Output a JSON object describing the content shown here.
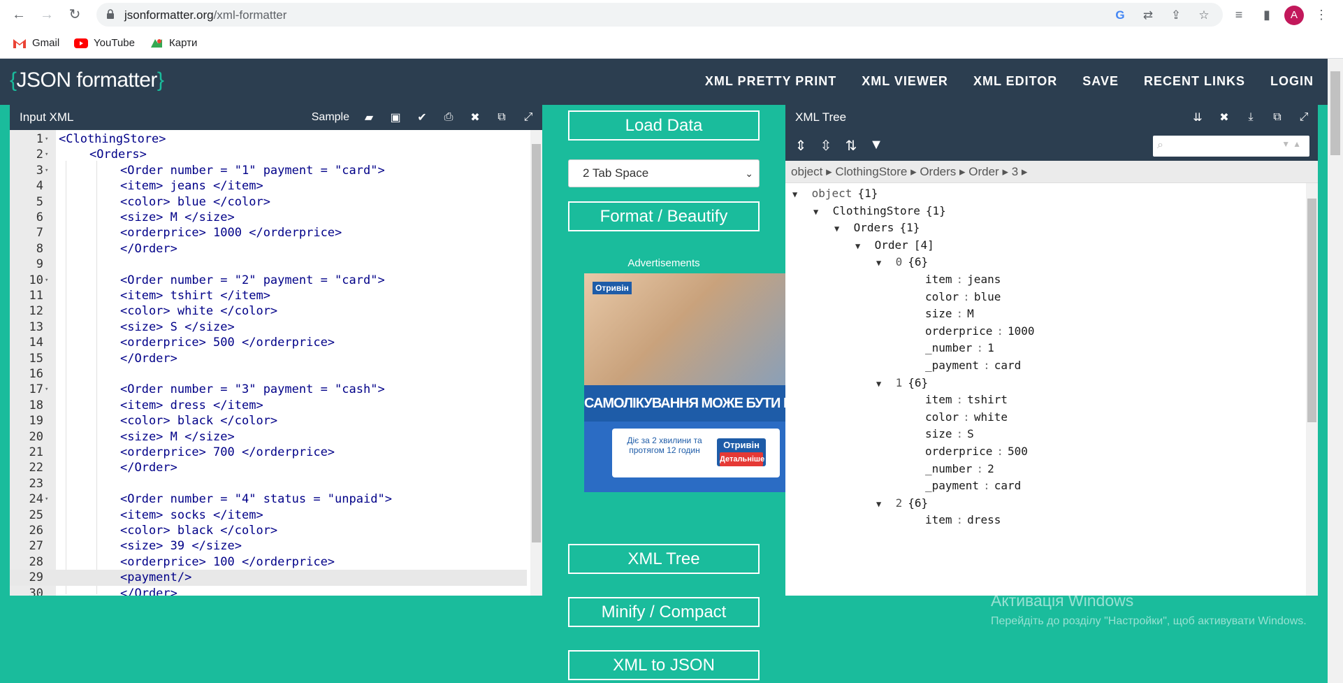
{
  "browser": {
    "url_host": "jsonformatter.org",
    "url_path": "/xml-formatter",
    "avatar_letter": "A",
    "bookmarks": [
      {
        "label": "Gmail",
        "icon": "gmail-icon"
      },
      {
        "label": "YouTube",
        "icon": "youtube-icon"
      },
      {
        "label": "Карти",
        "icon": "maps-icon"
      }
    ]
  },
  "site": {
    "logo_open": "{",
    "logo_text": "JSON formatter",
    "logo_close": "}",
    "nav": [
      "XML PRETTY PRINT",
      "XML VIEWER",
      "XML EDITOR",
      "SAVE",
      "RECENT LINKS",
      "LOGIN"
    ]
  },
  "input_panel": {
    "title": "Input XML",
    "sample_label": "Sample",
    "lines": [
      {
        "n": "1",
        "fold": true,
        "text": "<ClothingStore>",
        "indent": 0
      },
      {
        "n": "2",
        "fold": true,
        "text": "<Orders>",
        "indent": 1
      },
      {
        "n": "3",
        "fold": true,
        "text": "<Order number = \"1\" payment = \"card\">",
        "indent": 2
      },
      {
        "n": "4",
        "fold": false,
        "text": "<item> jeans </item>",
        "indent": 2
      },
      {
        "n": "5",
        "fold": false,
        "text": "<color> blue </color>",
        "indent": 2
      },
      {
        "n": "6",
        "fold": false,
        "text": "<size> M </size>",
        "indent": 2
      },
      {
        "n": "7",
        "fold": false,
        "text": "<orderprice> 1000 </orderprice>",
        "indent": 2
      },
      {
        "n": "8",
        "fold": false,
        "text": "</Order>",
        "indent": 2
      },
      {
        "n": "9",
        "fold": false,
        "text": "",
        "indent": 0
      },
      {
        "n": "10",
        "fold": true,
        "text": "<Order number = \"2\" payment = \"card\">",
        "indent": 2
      },
      {
        "n": "11",
        "fold": false,
        "text": "<item> tshirt </item>",
        "indent": 2
      },
      {
        "n": "12",
        "fold": false,
        "text": "<color> white </color>",
        "indent": 2
      },
      {
        "n": "13",
        "fold": false,
        "text": "<size> S </size>",
        "indent": 2
      },
      {
        "n": "14",
        "fold": false,
        "text": "<orderprice> 500 </orderprice>",
        "indent": 2
      },
      {
        "n": "15",
        "fold": false,
        "text": "</Order>",
        "indent": 2
      },
      {
        "n": "16",
        "fold": false,
        "text": "",
        "indent": 0
      },
      {
        "n": "17",
        "fold": true,
        "text": "<Order number = \"3\" payment = \"cash\">",
        "indent": 2
      },
      {
        "n": "18",
        "fold": false,
        "text": "<item> dress </item>",
        "indent": 2
      },
      {
        "n": "19",
        "fold": false,
        "text": "<color> black </color>",
        "indent": 2
      },
      {
        "n": "20",
        "fold": false,
        "text": "<size> M </size>",
        "indent": 2
      },
      {
        "n": "21",
        "fold": false,
        "text": "<orderprice> 700 </orderprice>",
        "indent": 2
      },
      {
        "n": "22",
        "fold": false,
        "text": "</Order>",
        "indent": 2
      },
      {
        "n": "23",
        "fold": false,
        "text": "",
        "indent": 0
      },
      {
        "n": "24",
        "fold": true,
        "text": "<Order number = \"4\" status = \"unpaid\">",
        "indent": 2
      },
      {
        "n": "25",
        "fold": false,
        "text": "<item> socks </item>",
        "indent": 2
      },
      {
        "n": "26",
        "fold": false,
        "text": "<color> black </color>",
        "indent": 2
      },
      {
        "n": "27",
        "fold": false,
        "text": "<size> 39 </size>",
        "indent": 2
      },
      {
        "n": "28",
        "fold": false,
        "text": "<orderprice> 100 </orderprice>",
        "indent": 2
      },
      {
        "n": "29",
        "fold": false,
        "text": "<payment/>",
        "indent": 2,
        "active": true
      },
      {
        "n": "30",
        "fold": false,
        "text": "</Order>",
        "indent": 2
      }
    ]
  },
  "middle": {
    "load_data": "Load Data",
    "tab_select": "2 Tab Space",
    "format": "Format / Beautify",
    "ads_label": "Advertisements",
    "ad_banner_text": "САМОЛІКУВАННЯ МОЖЕ БУТИ ШКІДЛИВИМ ДЛЯ ВАШОГО",
    "ad_brand": "Отривін",
    "ad_card_text": "Діє за 2 хвилини та протягом 12 годин",
    "ad_card_button": "Детальніше",
    "xml_tree": "XML Tree",
    "minify": "Minify / Compact",
    "xml_to_json": "XML to JSON"
  },
  "tree_panel": {
    "title": "XML Tree",
    "breadcrumb": "object ▸ ClothingStore ▸ Orders ▸ Order ▸ 3 ▸",
    "rows": [
      {
        "depth": 0,
        "tri": "▼",
        "key": "object",
        "count": "{1}",
        "grey": true
      },
      {
        "depth": 1,
        "tri": "▼",
        "key": "ClothingStore",
        "count": "{1}"
      },
      {
        "depth": 2,
        "tri": "▼",
        "key": "Orders",
        "count": "{1}"
      },
      {
        "depth": 3,
        "tri": "▼",
        "key": "Order",
        "count": "[4]"
      },
      {
        "depth": 4,
        "tri": "▼",
        "key": "0",
        "count": "{6}",
        "grey": true
      },
      {
        "depth": 5,
        "key": "item",
        "value": "jeans"
      },
      {
        "depth": 5,
        "key": "color",
        "value": "blue"
      },
      {
        "depth": 5,
        "key": "size",
        "value": "M"
      },
      {
        "depth": 5,
        "key": "orderprice",
        "value": "1000"
      },
      {
        "depth": 5,
        "key": "_number",
        "value": "1"
      },
      {
        "depth": 5,
        "key": "_payment",
        "value": "card"
      },
      {
        "depth": 4,
        "tri": "▼",
        "key": "1",
        "count": "{6}",
        "grey": true
      },
      {
        "depth": 5,
        "key": "item",
        "value": "tshirt"
      },
      {
        "depth": 5,
        "key": "color",
        "value": "white"
      },
      {
        "depth": 5,
        "key": "size",
        "value": "S"
      },
      {
        "depth": 5,
        "key": "orderprice",
        "value": "500"
      },
      {
        "depth": 5,
        "key": "_number",
        "value": "2"
      },
      {
        "depth": 5,
        "key": "_payment",
        "value": "card"
      },
      {
        "depth": 4,
        "tri": "▼",
        "key": "2",
        "count": "{6}",
        "grey": true
      },
      {
        "depth": 5,
        "key": "item",
        "value": "dress"
      }
    ]
  },
  "watermark": {
    "title": "Активація Windows",
    "subtitle": "Перейдіть до розділу \"Настройки\", щоб активувати Windows."
  }
}
